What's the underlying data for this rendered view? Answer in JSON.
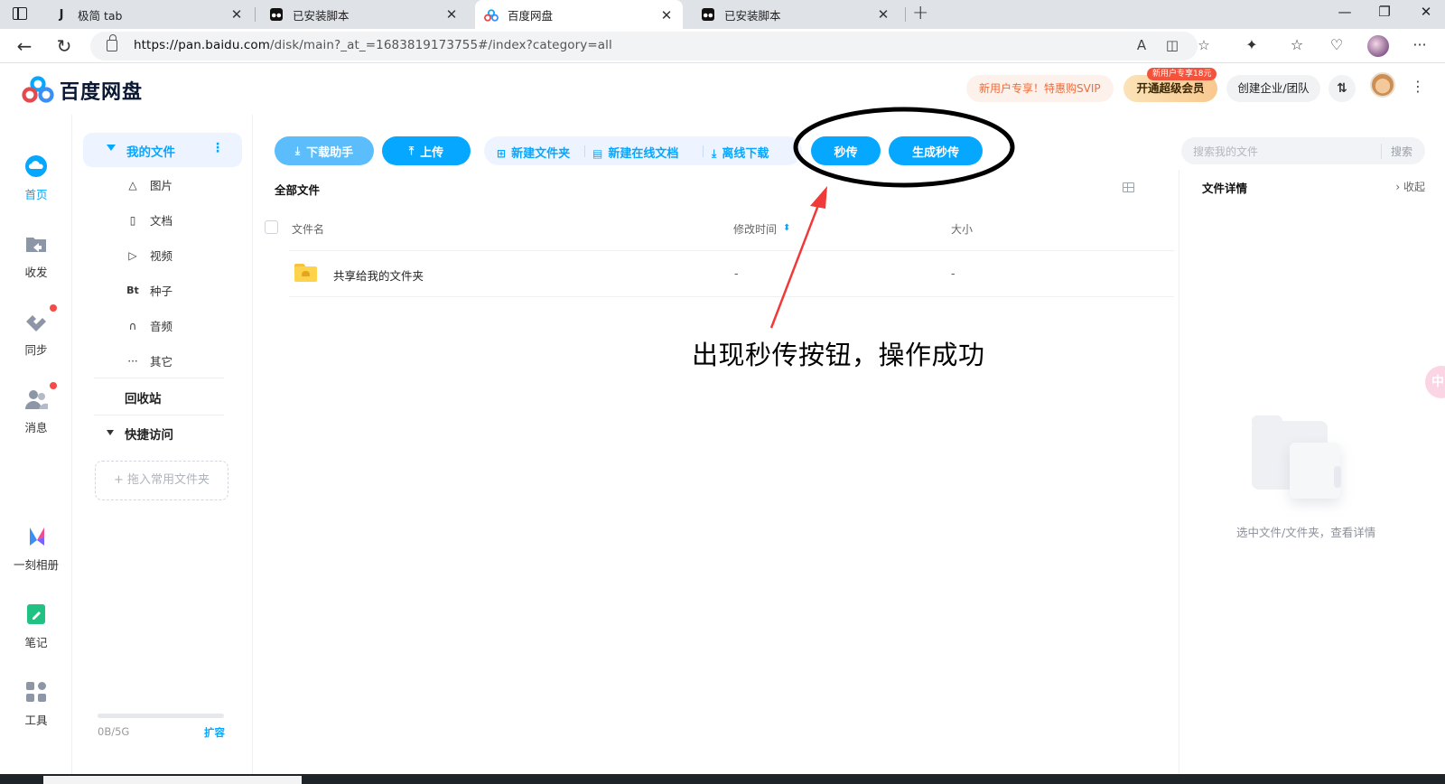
{
  "browser": {
    "tabs": [
      {
        "title": "极简 tab",
        "favicon": "J",
        "active": false
      },
      {
        "title": "已安装脚本",
        "favicon": "tampermonkey-icon",
        "active": false
      },
      {
        "title": "百度网盘",
        "favicon": "baidu-netdisk-icon",
        "active": true
      },
      {
        "title": "已安装脚本",
        "favicon": "tampermonkey-icon",
        "active": false
      }
    ],
    "url_host": "https://pan.baidu.com",
    "url_path": "/disk/main?_at_=1683819173755#/index?category=all"
  },
  "header": {
    "logo_text": "百度网盘",
    "promo_text": "新用户专享！特惠购SVIP",
    "svip_label": "开通超级会员",
    "svip_badge": "新用户专享18元",
    "team_label": "创建企业/团队"
  },
  "rail": {
    "items": [
      {
        "label": "首页",
        "icon": "cloud-icon",
        "active": true
      },
      {
        "label": "收发",
        "icon": "share-folder-icon",
        "active": false
      },
      {
        "label": "同步",
        "icon": "sync-icon",
        "active": false,
        "dot": true
      },
      {
        "label": "消息",
        "icon": "people-icon",
        "active": false,
        "dot": true
      },
      {
        "label": "一刻相册",
        "icon": "album-icon",
        "active": false
      },
      {
        "label": "笔记",
        "icon": "note-icon",
        "active": false
      },
      {
        "label": "工具",
        "icon": "tools-icon",
        "active": false
      }
    ]
  },
  "sidebar": {
    "my_files": "我的文件",
    "categories": [
      {
        "label": "图片",
        "icon": "image-icon"
      },
      {
        "label": "文档",
        "icon": "document-icon"
      },
      {
        "label": "视频",
        "icon": "video-icon"
      },
      {
        "label": "种子",
        "icon": "torrent-icon",
        "glyph": "Bt"
      },
      {
        "label": "音频",
        "icon": "headphone-icon"
      },
      {
        "label": "其它",
        "icon": "more-icon"
      }
    ],
    "recycle": "回收站",
    "quick_access": "快捷访问",
    "drop_hint": "+ 拖入常用文件夹",
    "quota_text": "0B/5G",
    "quota_fraction": 0,
    "expand": "扩容"
  },
  "toolbar": {
    "download_helper": "下载助手",
    "upload": "上传",
    "new_folder": "新建文件夹",
    "new_online_doc": "新建在线文档",
    "offline_download": "离线下载",
    "miao_chuan": "秒传",
    "gen_miao_chuan": "生成秒传",
    "search_placeholder": "搜索我的文件",
    "search_button": "搜索"
  },
  "file_list": {
    "breadcrumb": "全部文件",
    "columns": {
      "name": "文件名",
      "modified": "修改时间",
      "size": "大小"
    },
    "rows": [
      {
        "name": "共享给我的文件夹",
        "modified": "-",
        "size": "-"
      }
    ]
  },
  "detail_panel": {
    "title": "文件详情",
    "collapse": "收起",
    "empty_text": "选中文件/文件夹，查看详情"
  },
  "annotation": {
    "caption": "出现秒传按钮，操作成功",
    "ellipse_color": "#000000",
    "arrow_color": "#f03a3a"
  },
  "colors": {
    "accent": "#06a7ff",
    "accent_light": "#eef4ff",
    "promo": "#f06b3a"
  }
}
